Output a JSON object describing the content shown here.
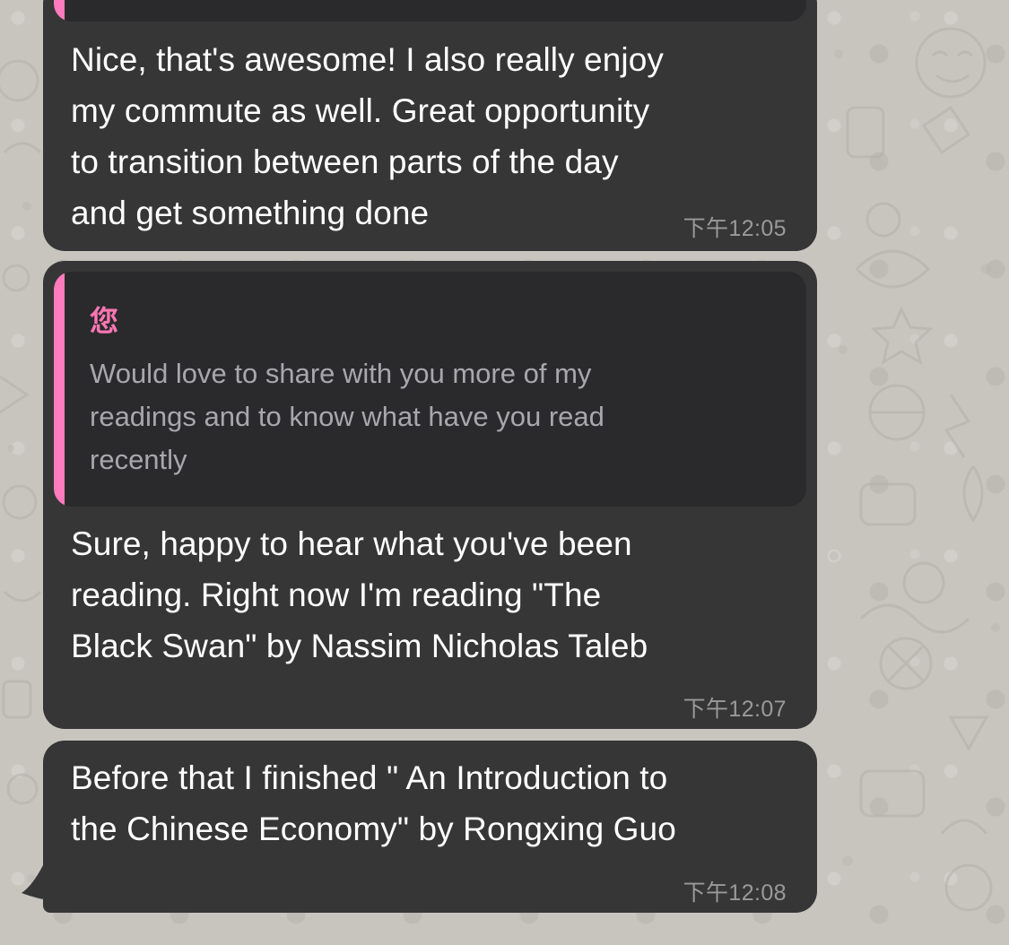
{
  "messages": [
    {
      "text": "Nice, that's awesome! I also really enjoy\nmy commute as well. Great opportunity\nto transition between parts of the day\nand get something done",
      "time": "下午12:05"
    },
    {
      "reply": {
        "author": "您",
        "text": "Would love to share with you more of my\nreadings and to know what have you read\nrecently"
      },
      "text": "Sure, happy to hear what you've been\nreading. Right now I'm reading \"The\nBlack Swan\" by Nassim Nicholas Taleb",
      "time": "下午12:07"
    },
    {
      "text": "Before that I finished \" An Introduction to\nthe Chinese Economy\" by Rongxing Guo",
      "time": "下午12:08"
    }
  ],
  "colors": {
    "bubble": "#363636",
    "quote_background": "#2a2a2c",
    "quote_accent": "#ff7bbd",
    "timestamp": "#9a9a9a",
    "wallpaper": "#c8c5bf"
  }
}
